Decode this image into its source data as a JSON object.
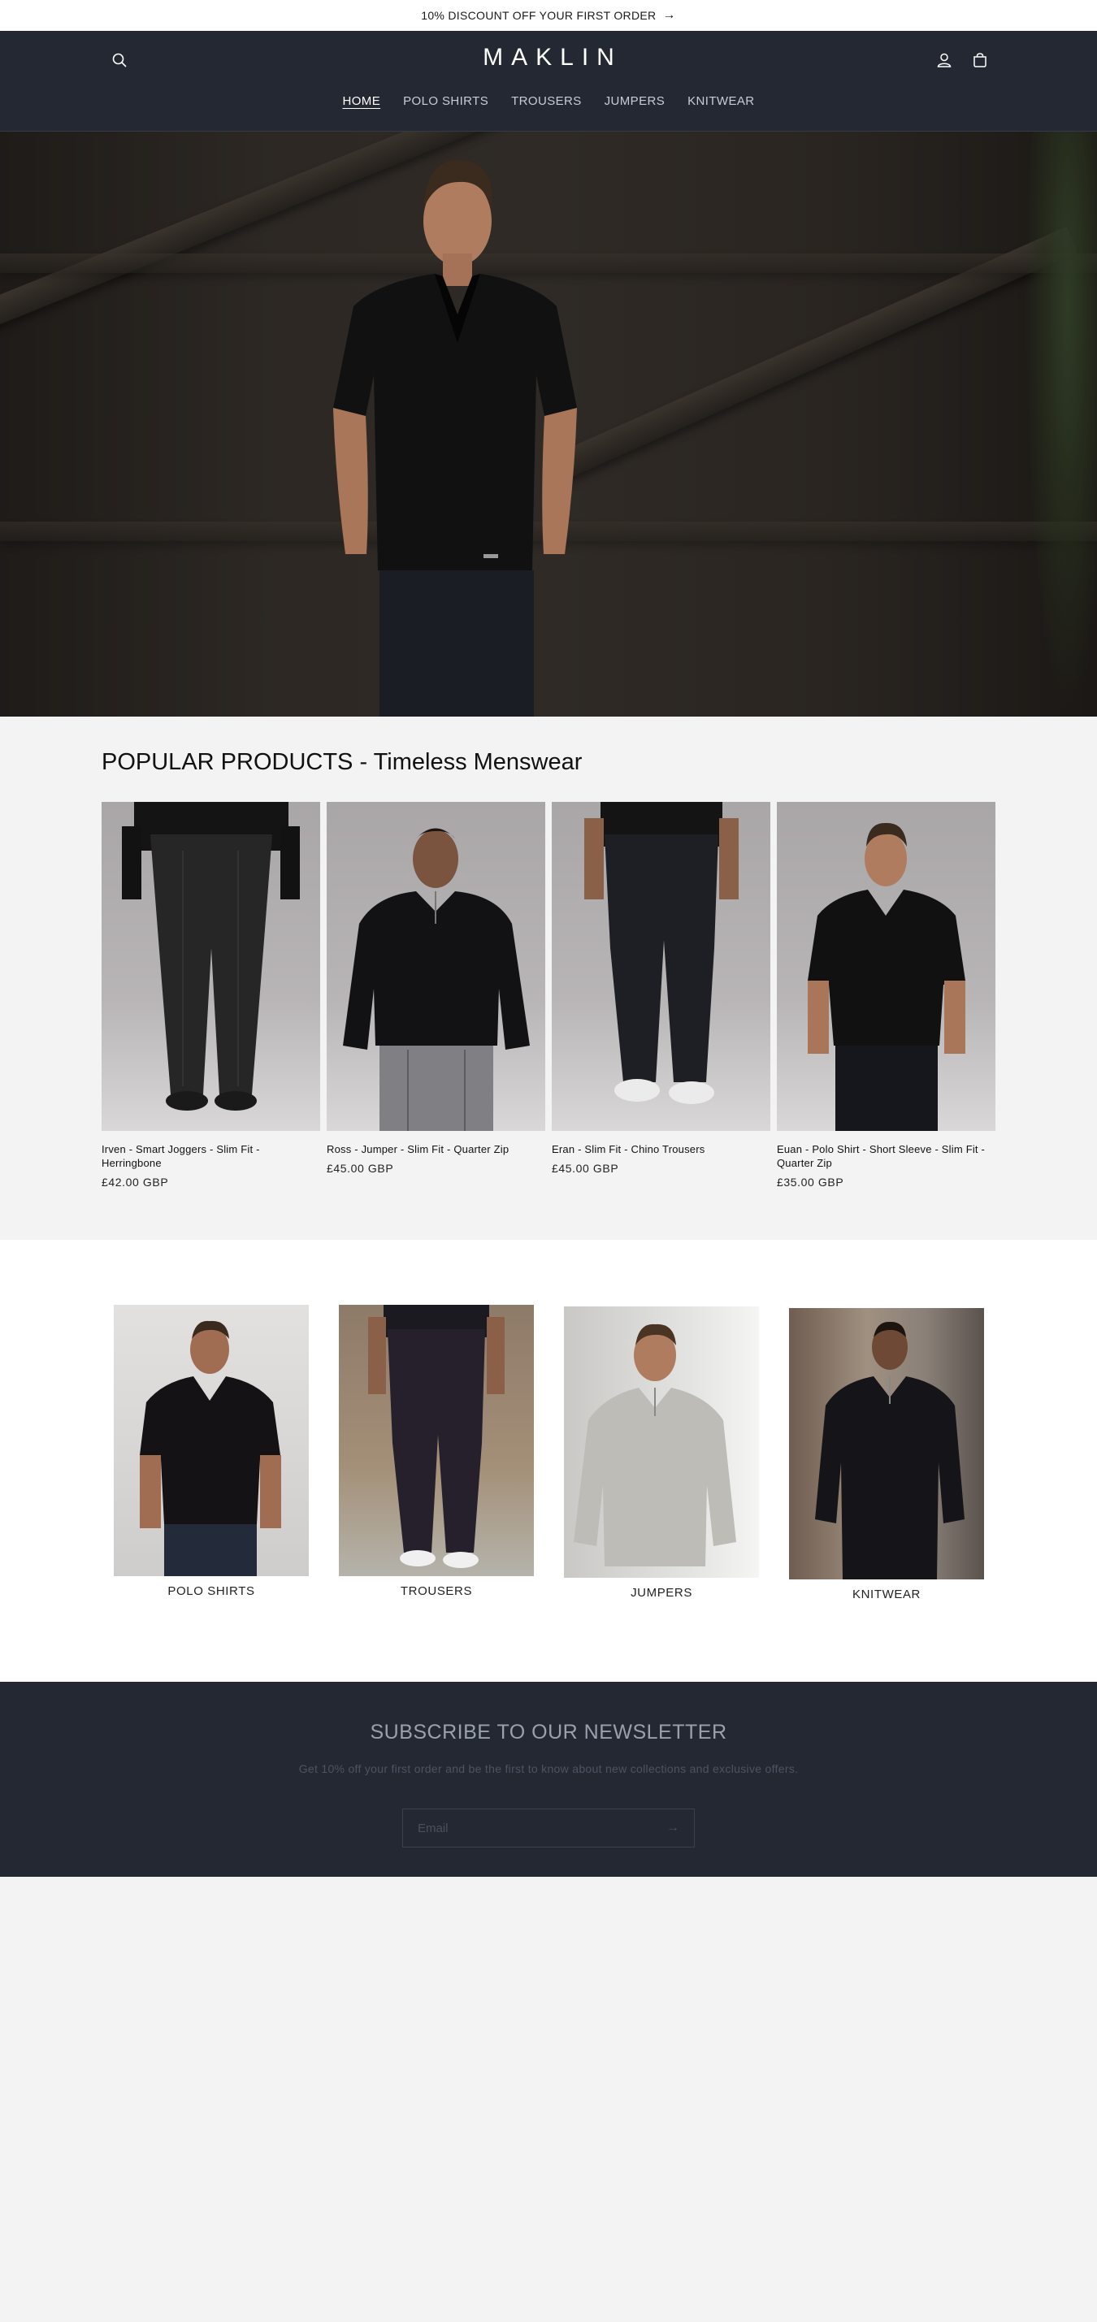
{
  "announcement": {
    "text": "10% DISCOUNT OFF YOUR FIRST ORDER",
    "arrow": "→"
  },
  "header": {
    "logo": "MAKLIN",
    "nav": [
      "HOME",
      "POLO SHIRTS",
      "TROUSERS",
      "JUMPERS",
      "KNITWEAR"
    ],
    "active_nav": "HOME",
    "icons": [
      "search-icon",
      "account-icon",
      "cart-icon"
    ]
  },
  "popular": {
    "heading": "POPULAR PRODUCTS - Timeless Menswear",
    "products": [
      {
        "title": "Irven - Smart Joggers - Slim Fit - Herringbone",
        "price": "£42.00 GBP"
      },
      {
        "title": "Ross - Jumper - Slim Fit - Quarter Zip",
        "price": "£45.00 GBP"
      },
      {
        "title": "Eran - Slim Fit - Chino Trousers",
        "price": "£45.00 GBP"
      },
      {
        "title": "Euan - Polo Shirt - Short Sleeve - Slim Fit - Quarter Zip",
        "price": "£35.00 GBP"
      }
    ]
  },
  "categories": [
    {
      "label": "POLO SHIRTS"
    },
    {
      "label": "TROUSERS"
    },
    {
      "label": "JUMPERS"
    },
    {
      "label": "KNITWEAR"
    }
  ],
  "newsletter": {
    "heading": "SUBSCRIBE TO OUR NEWSLETTER",
    "subtext": "Get 10% off your first order and be the first to know about new collections and exclusive offers.",
    "placeholder": "Email",
    "submit": "→"
  },
  "colors": {
    "header_bg": "#242833",
    "page_bg": "#f3f3f3",
    "announcement_bg": "#ffffff"
  }
}
